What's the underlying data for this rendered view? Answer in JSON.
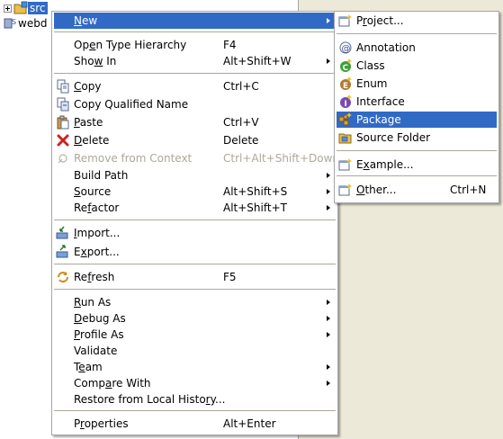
{
  "tree": {
    "rows": [
      {
        "label": "src",
        "selected": true
      },
      {
        "label": "webd",
        "selected": false
      }
    ]
  },
  "context_menu": {
    "items": [
      {
        "label": "New",
        "mnemonic_index": 0,
        "shortcut": "",
        "submenu": true,
        "highlighted": true,
        "icon": "none"
      },
      {
        "label": "Open Type Hierarchy",
        "mnemonic_index": 2,
        "shortcut": "F4",
        "submenu": false,
        "icon": "none"
      },
      {
        "label": "Show In",
        "mnemonic_index": 3,
        "shortcut": "Alt+Shift+W",
        "submenu": true,
        "icon": "none"
      },
      {
        "label": "Copy",
        "mnemonic_index": 0,
        "shortcut": "Ctrl+C",
        "submenu": false,
        "icon": "copy-icon"
      },
      {
        "label": "Copy Qualified Name",
        "mnemonic_index": -1,
        "shortcut": "",
        "submenu": false,
        "icon": "copy-qualified-name-icon"
      },
      {
        "label": "Paste",
        "mnemonic_index": 0,
        "shortcut": "Ctrl+V",
        "submenu": false,
        "icon": "paste-icon"
      },
      {
        "label": "Delete",
        "mnemonic_index": 0,
        "shortcut": "Delete",
        "submenu": false,
        "icon": "delete-icon"
      },
      {
        "label": "Remove from Context",
        "mnemonic_index": -1,
        "shortcut": "Ctrl+Alt+Shift+Down",
        "submenu": false,
        "disabled": true,
        "icon": "remove-context-icon"
      },
      {
        "label": "Build Path",
        "mnemonic_index": -1,
        "shortcut": "",
        "submenu": true,
        "icon": "none"
      },
      {
        "label": "Source",
        "mnemonic_index": 0,
        "shortcut": "Alt+Shift+S",
        "submenu": true,
        "icon": "none"
      },
      {
        "label": "Refactor",
        "mnemonic_index": 2,
        "shortcut": "Alt+Shift+T",
        "submenu": true,
        "icon": "none"
      },
      {
        "label": "Import...",
        "mnemonic_index": 0,
        "shortcut": "",
        "submenu": false,
        "icon": "import-icon"
      },
      {
        "label": "Export...",
        "mnemonic_index": 1,
        "shortcut": "",
        "submenu": false,
        "icon": "export-icon"
      },
      {
        "label": "Refresh",
        "mnemonic_index": 2,
        "shortcut": "F5",
        "submenu": false,
        "icon": "refresh-icon"
      },
      {
        "label": "Run As",
        "mnemonic_index": 0,
        "shortcut": "",
        "submenu": true,
        "icon": "none"
      },
      {
        "label": "Debug As",
        "mnemonic_index": 0,
        "shortcut": "",
        "submenu": true,
        "icon": "none"
      },
      {
        "label": "Profile As",
        "mnemonic_index": 0,
        "shortcut": "",
        "submenu": true,
        "icon": "none"
      },
      {
        "label": "Validate",
        "mnemonic_index": -1,
        "shortcut": "",
        "submenu": false,
        "icon": "none"
      },
      {
        "label": "Team",
        "mnemonic_index": 1,
        "shortcut": "",
        "submenu": true,
        "icon": "none"
      },
      {
        "label": "Compare With",
        "mnemonic_index": 4,
        "shortcut": "",
        "submenu": true,
        "icon": "none"
      },
      {
        "label": "Restore from Local History...",
        "mnemonic_index": 24,
        "shortcut": "",
        "submenu": false,
        "icon": "none"
      },
      {
        "label": "Properties",
        "mnemonic_index": 1,
        "shortcut": "Alt+Enter",
        "submenu": false,
        "icon": "none"
      }
    ]
  },
  "new_submenu": {
    "items": [
      {
        "label": "Project...",
        "mnemonic_index": 1,
        "shortcut": "",
        "icon": "new-project-icon"
      },
      {
        "label": "Annotation",
        "mnemonic_index": -1,
        "shortcut": "",
        "icon": "annotation-icon"
      },
      {
        "label": "Class",
        "mnemonic_index": -1,
        "shortcut": "",
        "icon": "class-icon"
      },
      {
        "label": "Enum",
        "mnemonic_index": -1,
        "shortcut": "",
        "icon": "enum-icon"
      },
      {
        "label": "Interface",
        "mnemonic_index": -1,
        "shortcut": "",
        "icon": "interface-icon"
      },
      {
        "label": "Package",
        "mnemonic_index": -1,
        "shortcut": "",
        "highlighted": true,
        "icon": "package-icon"
      },
      {
        "label": "Source Folder",
        "mnemonic_index": -1,
        "shortcut": "",
        "icon": "source-folder-icon"
      },
      {
        "label": "Example...",
        "mnemonic_index": 1,
        "shortcut": "",
        "icon": "example-icon"
      },
      {
        "label": "Other...",
        "mnemonic_index": 0,
        "shortcut": "Ctrl+N",
        "icon": "other-icon"
      }
    ]
  },
  "colors": {
    "highlight": "#316ac5",
    "menu_border": "#a7a6aa",
    "disabled_text": "#aca899",
    "workspace_bg": "#ece9d8"
  }
}
